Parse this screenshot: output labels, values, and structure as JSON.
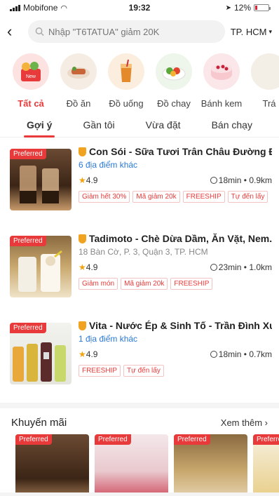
{
  "status_bar": {
    "carrier": "Mobifone",
    "time": "19:32",
    "battery": "12%"
  },
  "header": {
    "search_placeholder": "Nhập \"T6TATUA\" giảm 20K",
    "city": "TP. HCM"
  },
  "categories": [
    {
      "label": "Tất cả",
      "icon": "all-food-basket-icon",
      "active": true
    },
    {
      "label": "Đồ ăn",
      "icon": "food-plate-icon"
    },
    {
      "label": "Đồ uống",
      "icon": "drink-cup-icon"
    },
    {
      "label": "Đồ chay",
      "icon": "vegetarian-bowl-icon"
    },
    {
      "label": "Bánh kem",
      "icon": "cake-icon"
    },
    {
      "label": "Trá",
      "icon": "dessert-icon"
    }
  ],
  "tabs": [
    "Gợi ý",
    "Gần tôi",
    "Vừa đặt",
    "Bán chạy"
  ],
  "badge": "Preferred",
  "stores": [
    {
      "name": "Con Sói - Sữa Tươi Trân Châu Đường Đ...",
      "sub": "6 địa điểm khác",
      "rating": "4.9",
      "time_dist": "18min • 0.9km",
      "tags": [
        "Giảm hết 30%",
        "Mã giảm 20k",
        "FREESHIP",
        "Tự đến lấy"
      ]
    },
    {
      "name": "Tadimoto - Chè Dừa Dầm, Ăn Vặt, Nem...",
      "sub": "18 Bàn Cờ, P. 3, Quận 3, TP. HCM",
      "rating": "4.9",
      "time_dist": "23min • 1.0km",
      "tags": [
        "Giảm món",
        "Mã giảm 20k",
        "FREESHIP"
      ]
    },
    {
      "name": "Vita - Nước Ép & Sinh Tố - Trần Đình Xu",
      "sub": "1 địa điểm khác",
      "rating": "4.9",
      "time_dist": "18min • 0.7km",
      "tags": [
        "FREESHIP",
        "Tự đến lấy"
      ]
    }
  ],
  "promo": {
    "title": "Khuyến mãi",
    "more": "Xem thêm"
  },
  "colors": {
    "accent": "#e83a3a",
    "link": "#2b79d8",
    "star": "#f2a20b"
  }
}
